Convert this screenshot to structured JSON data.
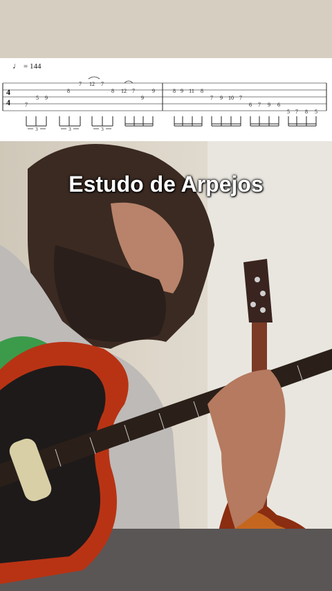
{
  "tablature": {
    "tempo_symbol": "♩",
    "tempo_value": "= 144",
    "time_signature": {
      "top": "4",
      "bottom": "4"
    },
    "triplet_mark": "3"
  },
  "video": {
    "caption": "Estudo de Arpejos"
  },
  "scene_icons": {
    "person": "guitarist-icon",
    "guitar": "electric-guitar-icon",
    "bass": "bass-guitar-icon"
  }
}
